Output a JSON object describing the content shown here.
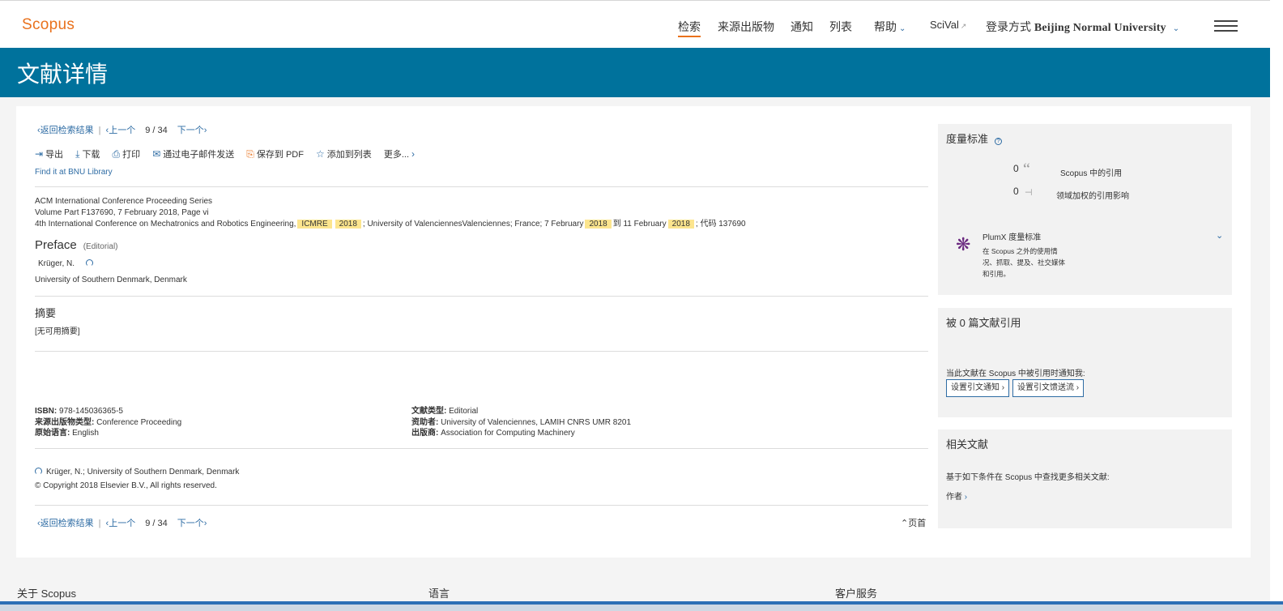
{
  "header": {
    "logo": "Scopus",
    "nav": [
      {
        "label": "检索",
        "active": true
      },
      {
        "label": "来源出版物"
      },
      {
        "label": "通知"
      },
      {
        "label": "列表"
      },
      {
        "label": "帮助"
      },
      {
        "label": "SciVal"
      },
      {
        "label_prefix": "登录方式",
        "label_bold": "Beijing Normal University"
      }
    ]
  },
  "banner": {
    "title": "文献详情"
  },
  "pager": {
    "back": "返回检索结果",
    "prev": "上一个",
    "current": "9",
    "total": "34",
    "next": "下一个",
    "separator": "/"
  },
  "toolbar": {
    "export": "导出",
    "download": "下载",
    "print": "打印",
    "email": "通过电子邮件发送",
    "save_pdf": "保存到 PDF",
    "add_list": "添加到列表",
    "more": "更多..."
  },
  "library_link": "Find it at BNU Library",
  "source": {
    "series": "ACM International Conference Proceeding Series",
    "volume": "Volume Part F137690, 7 February 2018, Page vi",
    "conf_prefix": "4th International Conference on Mechatronics and Robotics Engineering,",
    "hl1": "ICMRE",
    "hl2": "2018",
    "conf_mid": "; University of ValenciennesValenciennes; France; 7 February",
    "hl3": "2018",
    "conf_mid2": "到 11 February",
    "hl4": "2018",
    "conf_suffix": "; 代码 137690"
  },
  "document": {
    "title": "Preface",
    "type_label": "(Editorial)",
    "author": "Krüger, N.",
    "affiliation": "University of Southern Denmark, Denmark"
  },
  "abstract": {
    "heading": "摘要",
    "text": "[无可用摘要]"
  },
  "info": {
    "isbn_label": "ISBN:",
    "isbn": "978-145036365-5",
    "source_type_label": "来源出版物类型:",
    "source_type": "Conference Proceeding",
    "language_label": "原始语言:",
    "language": "English",
    "doc_type_label": "文献类型:",
    "doc_type": "Editorial",
    "funder_label": "资助者:",
    "funder": "University of Valenciennes, LAMIH CNRS UMR 8201",
    "publisher_label": "出版商:",
    "publisher": "Association for Computing Machinery"
  },
  "correspondence": "Krüger, N.; University of Southern Denmark, Denmark",
  "copyright": "© Copyright 2018 Elsevier B.V., All rights reserved.",
  "back_to_top": "页首",
  "metrics": {
    "heading": "度量标准",
    "scopus_count": "0",
    "scopus_label": "Scopus 中的引用",
    "fwci_count": "0",
    "fwci_label": "领域加权的引用影响",
    "plumx_title": "PlumX 度量标准",
    "plumx_desc1": "在 Scopus 之外的使用情",
    "plumx_desc2": "况、抓取、提及、社交媒体",
    "plumx_desc3": "和引用。"
  },
  "cited_by": {
    "heading": "被 0 篇文献引用",
    "notify_text": "当此文献在 Scopus 中被引用时通知我:",
    "alert_btn": "设置引文通知",
    "feed_btn": "设置引文馈送流"
  },
  "related": {
    "heading": "相关文献",
    "desc": "基于如下条件在 Scopus 中查找更多相关文献:",
    "authors": "作者"
  },
  "footer": {
    "about": "关于 Scopus",
    "language": "语言",
    "service": "客户服务"
  }
}
